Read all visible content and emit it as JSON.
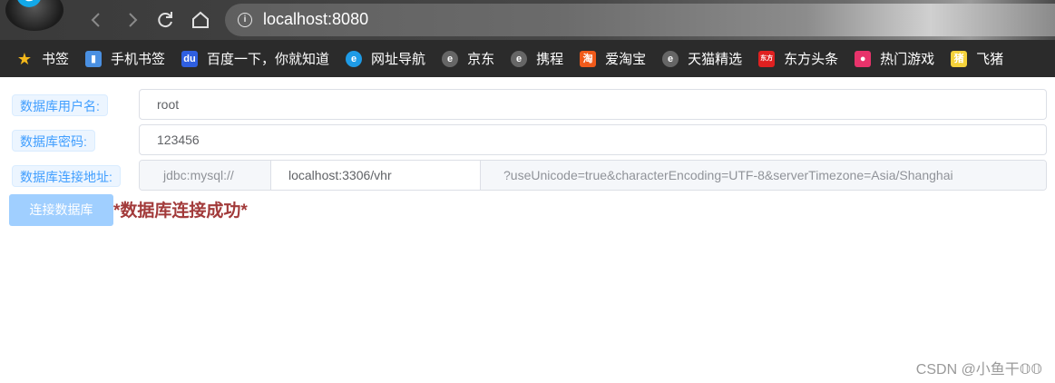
{
  "browser": {
    "address": "localhost:8080",
    "bookmarks": [
      {
        "label": "书签",
        "icon": "star-icon",
        "color": "#f6b91a"
      },
      {
        "label": "手机书签",
        "icon": "phone-bookmark-icon",
        "color": "#4a90e2"
      },
      {
        "label": "百度一下，你就知道",
        "icon": "baidu-icon",
        "color": "#2f5fe0"
      },
      {
        "label": "网址导航",
        "icon": "ie-icon",
        "color": "#1e9be6"
      },
      {
        "label": "京东",
        "icon": "ie-gray-icon",
        "color": "#666666"
      },
      {
        "label": "携程",
        "icon": "ie-gray-icon",
        "color": "#666666"
      },
      {
        "label": "爱淘宝",
        "icon": "taobao-icon",
        "color": "#f05a1a"
      },
      {
        "label": "天猫精选",
        "icon": "ie-gray-icon",
        "color": "#666666"
      },
      {
        "label": "东方头条",
        "icon": "dongfang-icon",
        "color": "#e02020"
      },
      {
        "label": "热门游戏",
        "icon": "game-icon",
        "color": "#e8336b"
      },
      {
        "label": "飞猪",
        "icon": "fliggy-icon",
        "color": "#f5d23a"
      }
    ]
  },
  "form": {
    "username_label": "数据库用户名:",
    "username_value": "root",
    "password_label": "数据库密码:",
    "password_value": "123456",
    "url_label": "数据库连接地址:",
    "url_prefix": "jdbc:mysql://",
    "url_value": "localhost:3306/vhr",
    "url_suffix": "?useUnicode=true&characterEncoding=UTF-8&serverTimezone=Asia/Shanghai",
    "connect_button": "连接数据库",
    "status_message": "*数据库连接成功*"
  },
  "watermark": "CSDN @小鱼干𝕆𝕆"
}
